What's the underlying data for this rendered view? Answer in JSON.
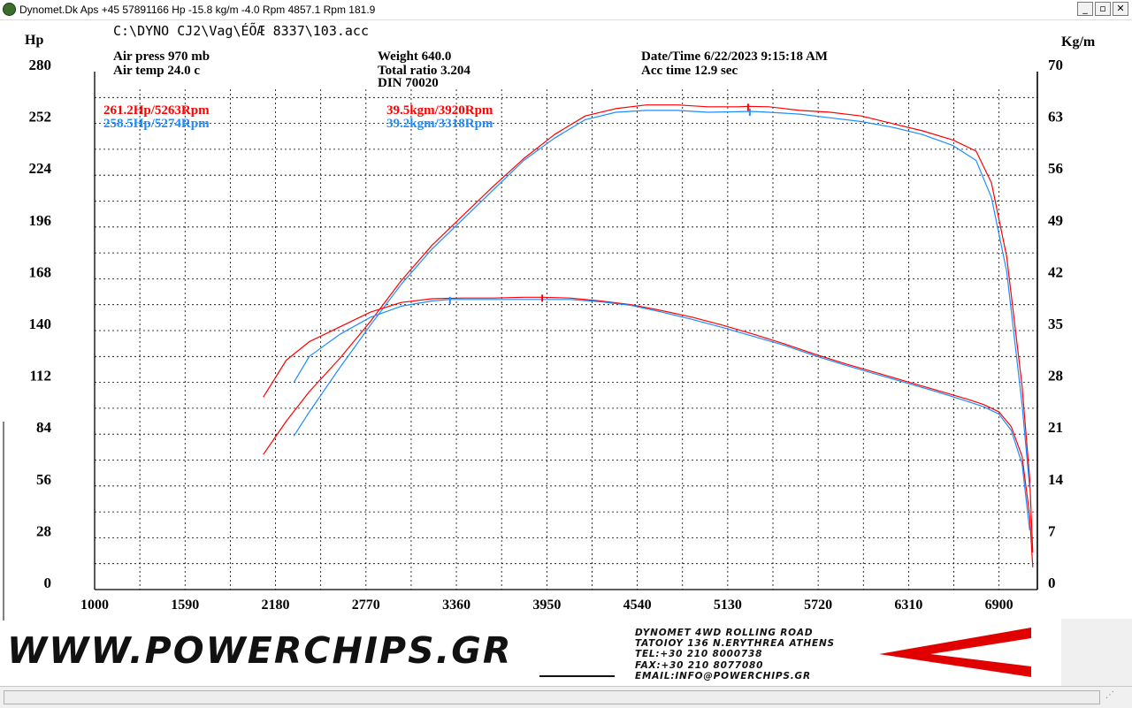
{
  "window": {
    "title": "Dynomet.Dk Aps +45 57891166 Hp -15.8 kg/m -4.0 Rpm 4857.1 Rpm 181.9",
    "controls": {
      "minimize": "_",
      "maximize": "▫",
      "close": "✕"
    }
  },
  "header": {
    "file_path": "C:\\DYNO CJ2\\Vag\\ÉÕÆ 8337\\103.acc",
    "air_press": "Air press  970 mb",
    "air_temp": "Air temp  24.0 c",
    "weight": "Weight   640.0",
    "total_ratio": "Total ratio 3.204",
    "din": "DIN 70020",
    "datetime": "Date/Time  6/22/2023 9:15:18 AM",
    "acc_time": "Acc time  12.9 sec"
  },
  "peaks": {
    "red_hp": "261.2Hp/5263Rpm",
    "blue_hp": "258.5Hp/5274Rpm",
    "red_torque": "39.5kgm/3920Rpm",
    "blue_torque": "39.2kgm/3318Rpm"
  },
  "colors": {
    "red": "#ff0000",
    "blue": "#1e8cff",
    "grid": "#000000",
    "axis": "#000000"
  },
  "chart_data": {
    "type": "line",
    "xlim": [
      1000,
      7150
    ],
    "x_ticks": [
      1000,
      1590,
      2180,
      2770,
      3360,
      3950,
      4540,
      5130,
      5720,
      6310,
      6900
    ],
    "y_left": {
      "label": "Hp",
      "ticks": [
        0,
        28,
        56,
        84,
        112,
        140,
        168,
        196,
        224,
        252,
        280
      ],
      "range": [
        0,
        280
      ]
    },
    "y_right": {
      "label": "Kg/m",
      "ticks": [
        0,
        7,
        14,
        21,
        28,
        35,
        42,
        49,
        56,
        63,
        70
      ],
      "range": [
        0,
        70
      ]
    },
    "series": [
      {
        "axis": "left",
        "color": "red",
        "x": [
          2100,
          2250,
          2400,
          2600,
          2800,
          3000,
          3200,
          3400,
          3600,
          3800,
          4000,
          4200,
          4400,
          4600,
          4800,
          5000,
          5200,
          5263,
          5400,
          5600,
          5800,
          6000,
          6200,
          6400,
          6600,
          6750,
          6850,
          6950,
          7050,
          7100,
          7120
        ],
        "y": [
          73,
          91,
          107,
          125,
          145,
          167,
          186,
          202,
          218,
          233,
          246,
          256,
          260,
          262,
          262,
          261,
          261,
          261.2,
          261,
          259,
          258,
          256,
          252,
          248,
          243,
          237,
          220,
          180,
          110,
          60,
          20
        ]
      },
      {
        "axis": "left",
        "color": "blue",
        "x": [
          2300,
          2400,
          2600,
          2800,
          3000,
          3200,
          3400,
          3600,
          3800,
          4000,
          4200,
          4400,
          4600,
          4800,
          5000,
          5200,
          5274,
          5400,
          5600,
          5800,
          6000,
          6200,
          6400,
          6600,
          6750,
          6850,
          6950,
          7050,
          7100
        ],
        "y": [
          83,
          96,
          120,
          143,
          165,
          184,
          200,
          216,
          232,
          244,
          254,
          258,
          259,
          259,
          258,
          258.3,
          258.5,
          258,
          257,
          255,
          253,
          250,
          246,
          240,
          232,
          212,
          172,
          100,
          55
        ]
      },
      {
        "axis": "right",
        "color": "red",
        "x": [
          2100,
          2250,
          2400,
          2600,
          2800,
          3000,
          3200,
          3400,
          3600,
          3800,
          3920,
          4100,
          4300,
          4500,
          4700,
          4900,
          5100,
          5300,
          5500,
          5700,
          5900,
          6100,
          6300,
          6500,
          6700,
          6800,
          6900,
          6980,
          7050,
          7100,
          7120
        ],
        "y": [
          26,
          31,
          33.5,
          35.5,
          37.5,
          38.8,
          39.3,
          39.4,
          39.4,
          39.5,
          39.5,
          39.4,
          39,
          38.5,
          37.7,
          36.8,
          35.7,
          34.5,
          33.2,
          31.8,
          30.5,
          29.3,
          28.1,
          26.9,
          25.7,
          25,
          24,
          22,
          18,
          10,
          3
        ]
      },
      {
        "axis": "right",
        "color": "blue",
        "x": [
          2300,
          2400,
          2600,
          2800,
          3000,
          3200,
          3318,
          3500,
          3700,
          3900,
          4100,
          4300,
          4500,
          4700,
          4900,
          5100,
          5300,
          5500,
          5700,
          5900,
          6100,
          6300,
          6500,
          6700,
          6800,
          6900,
          6980,
          7050,
          7100
        ],
        "y": [
          28,
          31.5,
          34.5,
          36.8,
          38.3,
          39,
          39.2,
          39.2,
          39.2,
          39.2,
          39.2,
          38.9,
          38.4,
          37.5,
          36.5,
          35.4,
          34.2,
          33,
          31.6,
          30.3,
          29.1,
          27.9,
          26.7,
          25.4,
          24.7,
          23.7,
          21.5,
          17,
          8
        ]
      }
    ],
    "markers": [
      {
        "axis": "left",
        "color": "red",
        "x": 5263,
        "y": 261.2
      },
      {
        "axis": "left",
        "color": "blue",
        "x": 5274,
        "y": 258.5
      },
      {
        "axis": "right",
        "color": "red",
        "x": 3920,
        "y": 39.5
      },
      {
        "axis": "right",
        "color": "blue",
        "x": 3318,
        "y": 39.2
      }
    ],
    "grid": true
  },
  "footer": {
    "url": "WWW.POWERCHIPS.GR",
    "info": [
      "DYNOMET 4WD ROLLING ROAD",
      "TATOIOY 136 N.ERYTHREA ATHENS",
      "TEL:+30 210 8000738",
      "FAX:+30 210 8077080",
      "EMAIL:INFO@POWERCHIPS.GR"
    ]
  }
}
